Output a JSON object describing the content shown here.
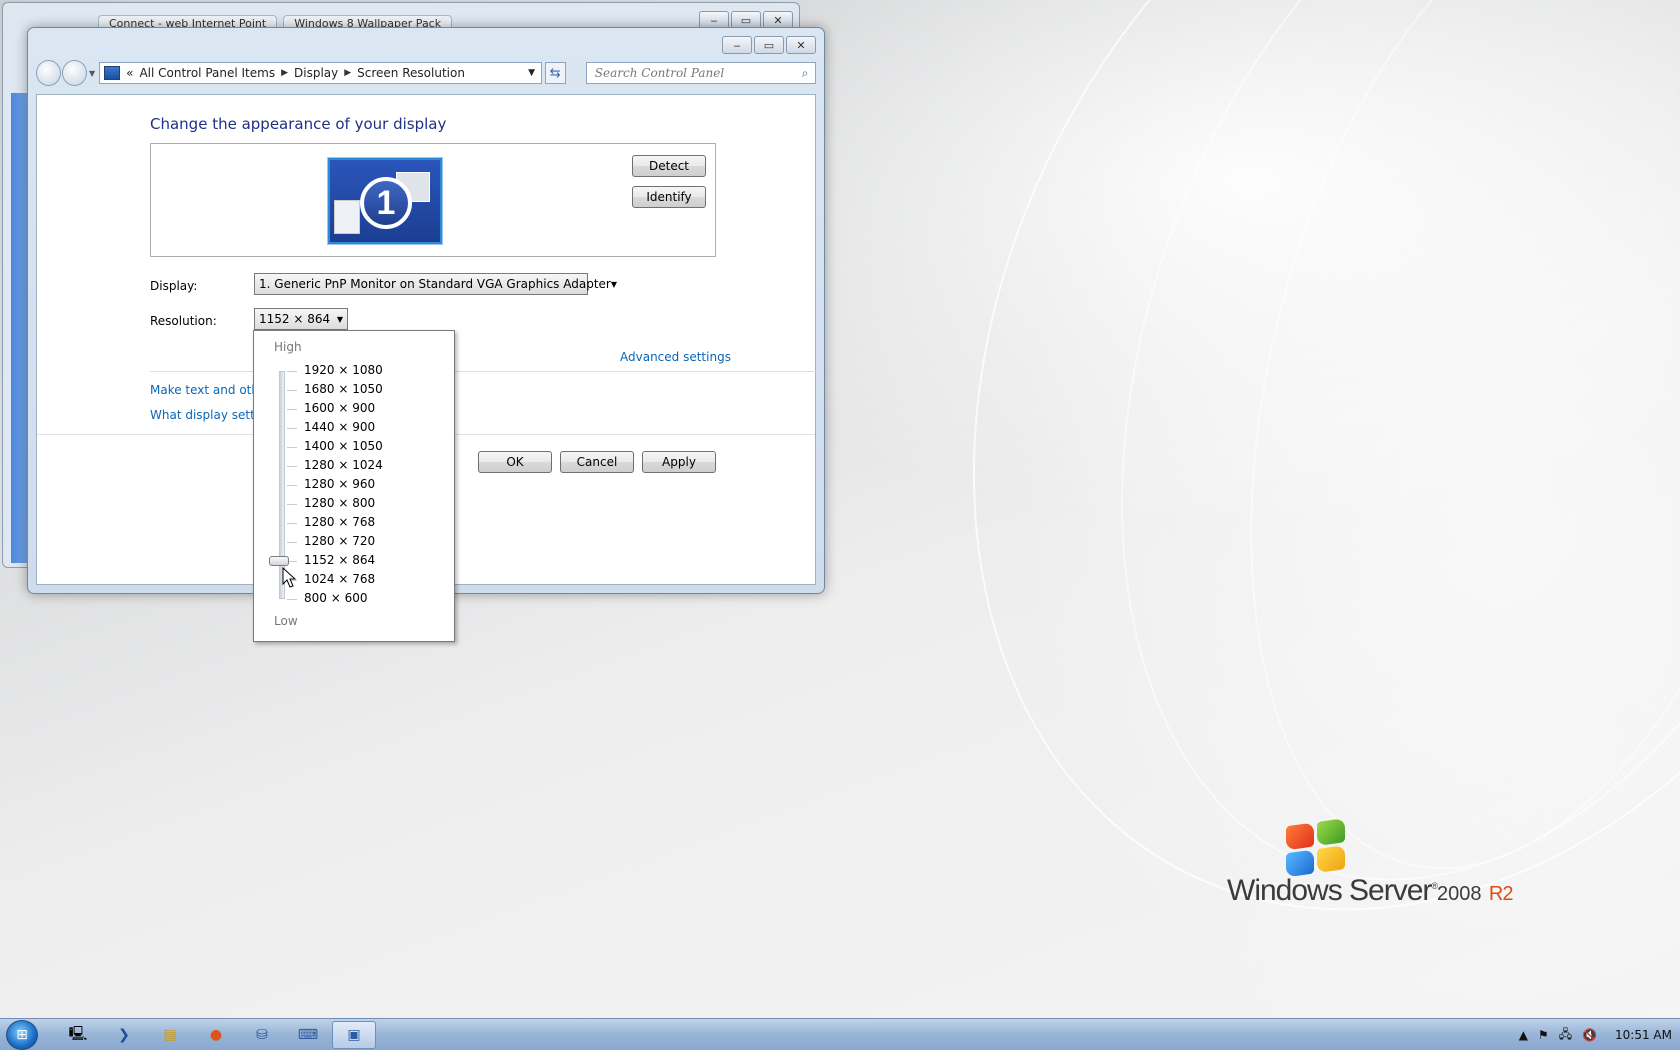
{
  "background_window": {
    "tabs": [
      "Connect - web Internet Point",
      "Windows 8 Wallpaper Pack"
    ],
    "controls": [
      "minimize",
      "maximize",
      "close"
    ]
  },
  "window": {
    "controls": {
      "minimize": "‒",
      "maximize": "▭",
      "close": "✕"
    },
    "breadcrumb": [
      "All Control Panel Items",
      "Display",
      "Screen Resolution"
    ],
    "breadcrumb_prefix": "«",
    "search_placeholder": "Search Control Panel",
    "heading": "Change the appearance of your display",
    "detect_label": "Detect",
    "identify_label": "Identify",
    "monitor_number": "1",
    "display_label": "Display:",
    "display_value": "1. Generic PnP Monitor on Standard VGA Graphics Adapter",
    "resolution_label": "Resolution:",
    "resolution_value": "1152 × 864",
    "advanced_settings": "Advanced settings",
    "link_text_size": "Make text and other",
    "link_display_settings": "What display setting",
    "ok_label": "OK",
    "cancel_label": "Cancel",
    "apply_label": "Apply"
  },
  "resolution_dropdown": {
    "high_label": "High",
    "low_label": "Low",
    "options": [
      "1920 × 1080",
      "1680 × 1050",
      "1600 × 900",
      "1440 × 900",
      "1400 × 1050",
      "1280 × 1024",
      "1280 × 960",
      "1280 × 800",
      "1280 × 768",
      "1280 × 720",
      "1152 × 864",
      "1024 × 768",
      "800 × 600"
    ],
    "selected_index": 10
  },
  "branding": {
    "name": "Windows Server",
    "version": "2008",
    "edition": "R2"
  },
  "taskbar": {
    "apps": [
      "server-manager-icon",
      "powershell-icon",
      "explorer-icon",
      "firefox-icon",
      "network-icon",
      "keyboard-icon",
      "display-icon"
    ],
    "clock": "10:51 AM",
    "tray_icons": [
      "show-hidden-icon",
      "action-center-flag-icon",
      "network-tray-icon",
      "volume-muted-icon"
    ]
  },
  "colors": {
    "link": "#0b66b6",
    "heading": "#1e3287",
    "brand_accent": "#e04b17"
  }
}
